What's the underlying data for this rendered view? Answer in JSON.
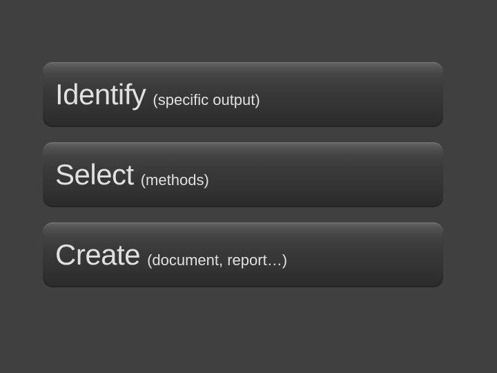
{
  "bars": {
    "identify": {
      "title": "Identify",
      "subtitle": "(specific output)"
    },
    "select": {
      "title": "Select",
      "subtitle": "(methods)"
    },
    "create": {
      "title": "Create",
      "subtitle": "(document, report…)"
    }
  }
}
